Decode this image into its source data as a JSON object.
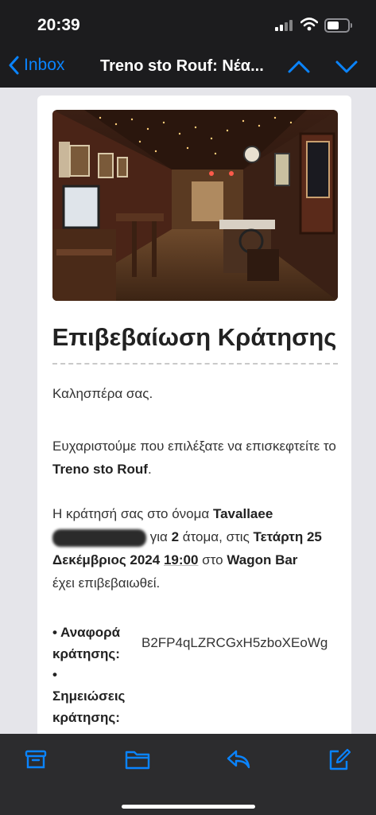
{
  "status": {
    "time": "20:39"
  },
  "nav": {
    "back_label": "Inbox",
    "title": "Treno sto Rouf: Νέα..."
  },
  "email": {
    "heading": "Επιβεβαίωση Κράτησης",
    "greeting": "Καλησπέρα σας.",
    "thanks_prefix": "Ευχαριστούμε που επιλέξατε να επισκεφτείτε το ",
    "venue": "Treno sto Rouf",
    "thanks_suffix": ".",
    "booking_prefix": "Η κράτησή σας στο όνομα ",
    "guest_name": "Tavallaee",
    "for_text": " για ",
    "party_size": "2",
    "persons_text": " άτομα, στις ",
    "date": "Τετάρτη 25 Δεκέμβριος 2024",
    "time": "19:00",
    "at_text": " στο ",
    "location": "Wagon Bar",
    "confirmed_text": "έχει επιβεβαιωθεί.",
    "ref_label": "Αναφορά κράτησης:",
    "ref_value": "B2FP4qLZRCGxH5zboXEoWg",
    "notes_label": "Σημειώσεις κράτησης:"
  },
  "colors": {
    "accent": "#0a84ff",
    "toolbar": "#2c2c2e"
  },
  "icons": [
    "chevron-left-icon",
    "chevron-up-icon",
    "chevron-down-icon",
    "archive-icon",
    "folder-icon",
    "reply-icon",
    "compose-icon"
  ]
}
